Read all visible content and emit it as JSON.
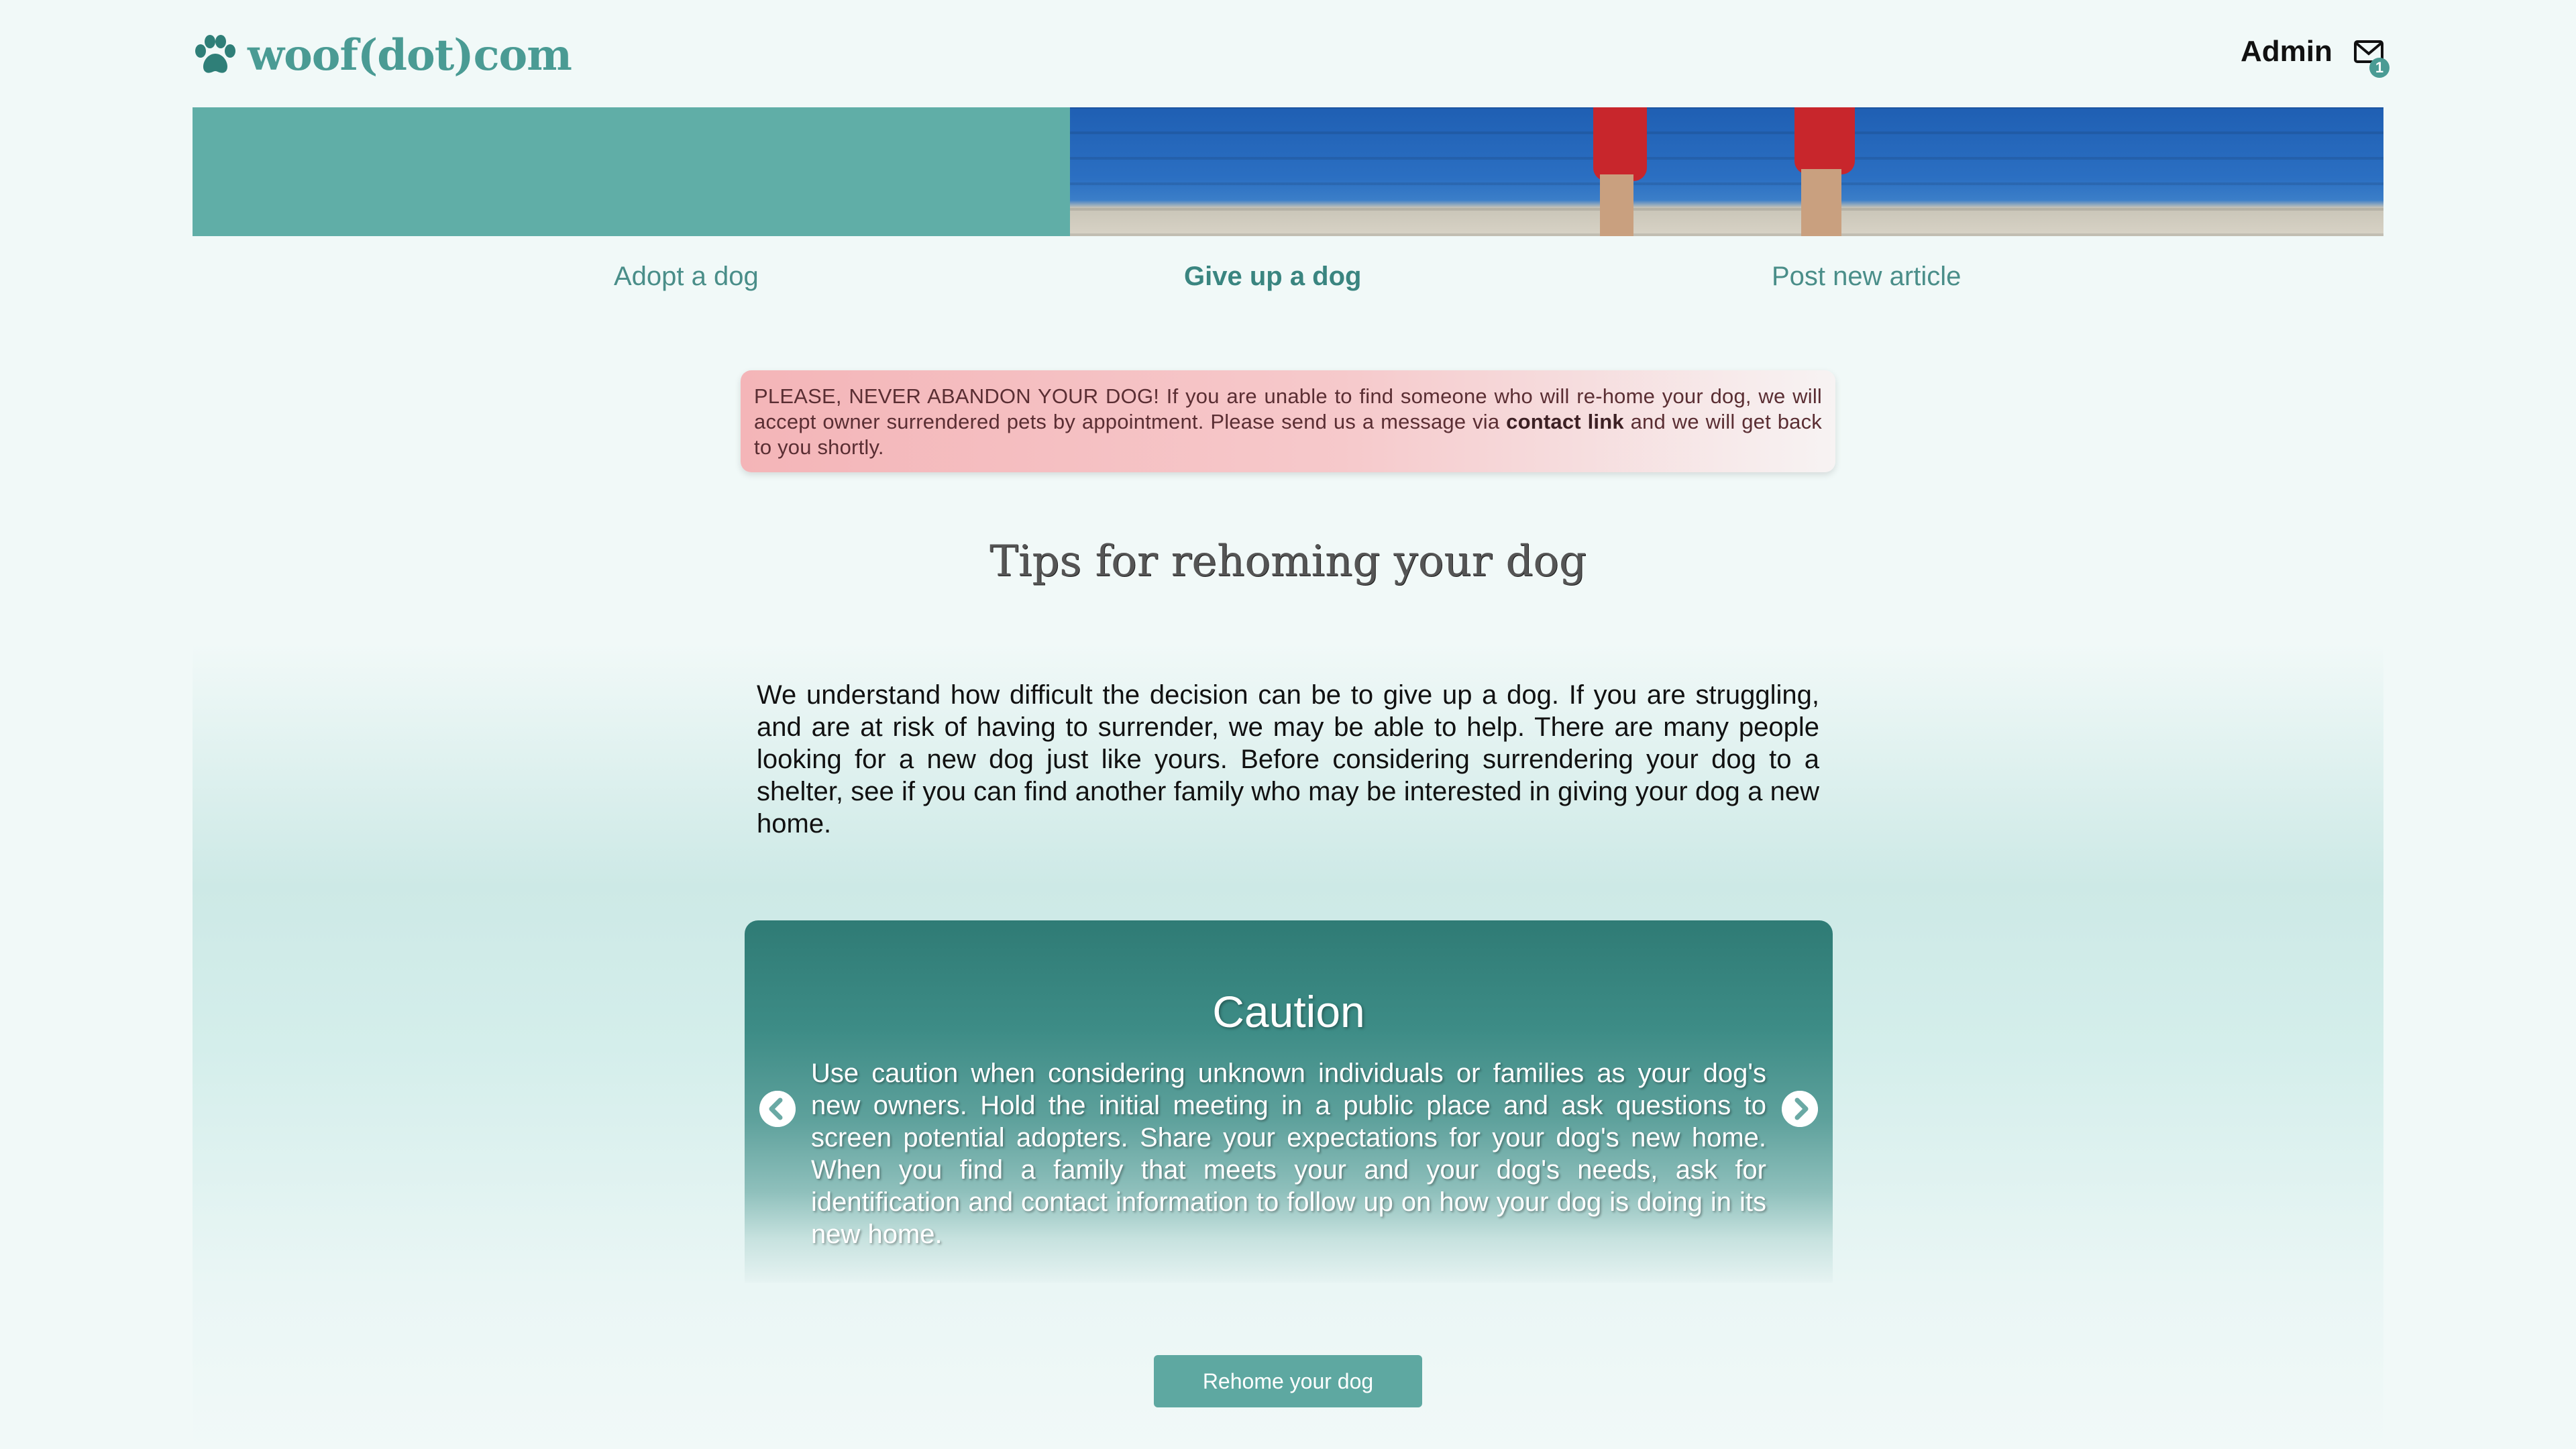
{
  "header": {
    "logo_text": "woof(dot)com",
    "user_name": "Admin",
    "mail_count": "1"
  },
  "nav": {
    "items": [
      {
        "label": "Adopt a dog",
        "active": false
      },
      {
        "label": "Give up a dog",
        "active": true
      },
      {
        "label": "Post new article",
        "active": false
      }
    ]
  },
  "alert": {
    "text_before": "PLEASE, NEVER ABANDON YOUR DOG! If you are unable to find someone who will re-home your dog, we will accept owner surrendered pets by appointment. Please send us a message via ",
    "link": "contact link",
    "text_after": " and we will get back to you shortly."
  },
  "main": {
    "title": "Tips for rehoming your dog",
    "intro": "We understand how difficult the decision can be to give up a dog. If you are struggling, and are at risk of having to surrender, we may be able to help. There are many people looking for a new dog just like yours. Before considering surrendering your dog to a shelter, see if you can find another family who may be interested in giving your dog a new home."
  },
  "carousel": {
    "title": "Caution",
    "text": "Use caution when considering unknown individuals or families as your dog's new owners. Hold the initial meeting in a public place and ask questions to screen potential adopters. Share your expectations for your dog's new home. When you find a family that meets your and your dog's needs, ask for identification and contact information to follow up on how your dog is doing in its new home."
  },
  "actions": {
    "rehome_label": "Rehome your dog"
  },
  "colors": {
    "brand": "#4a9b94",
    "alert_bg": "#f4b5b8",
    "button": "#5ea8a1"
  },
  "icons": [
    "paw-icon",
    "mail-icon",
    "chevron-left-icon",
    "chevron-right-icon"
  ]
}
